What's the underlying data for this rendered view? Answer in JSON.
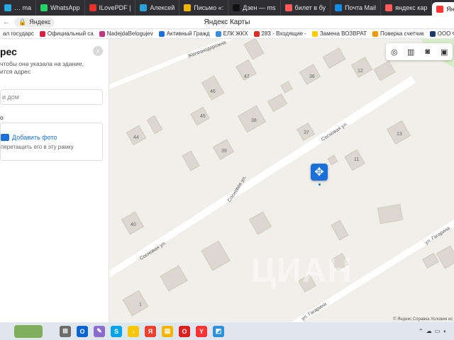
{
  "browser": {
    "tabs": [
      {
        "label": "… ma",
        "color": "#2aa8e0"
      },
      {
        "label": "WhatsApp",
        "color": "#25d366"
      },
      {
        "label": "ILovePDF |",
        "color": "#e5322d"
      },
      {
        "label": "Алексей",
        "color": "#2aa1da"
      },
      {
        "label": "Письмо «:",
        "color": "#f5b400"
      },
      {
        "label": "Дзен — ms",
        "color": "#111111"
      },
      {
        "label": "билет в бу",
        "color": "#ff5a5a"
      },
      {
        "label": "Почта Mail",
        "color": "#168de2"
      },
      {
        "label": "яндекс кар",
        "color": "#ff5a5a"
      },
      {
        "label": "Яндекс К",
        "color": "#ff3333",
        "active": true
      }
    ],
    "new_tab_label": "+",
    "site_chip": "Яндекс",
    "page_title": "Яндекс Карты"
  },
  "bookmarks": [
    {
      "label": "ал государс",
      "color": "#888888"
    },
    {
      "label": "Официальный са",
      "color": "#d4213d"
    },
    {
      "label": "NadejdaBelogujev",
      "color": "#c13584"
    },
    {
      "label": "Активный Гражд",
      "color": "#1e6fd9"
    },
    {
      "label": "ЕЛК ЖКХ",
      "color": "#3b8dd8"
    },
    {
      "label": "283 - Входящие -",
      "color": "#d93025"
    },
    {
      "label": "Замена ВОЗВРАТ",
      "color": "#ffcc00"
    },
    {
      "label": "Поверка счетчик",
      "color": "#f29900"
    },
    {
      "label": "ООО ФГИС",
      "color": "#1a3a6b"
    }
  ],
  "sidebar": {
    "title": "рес",
    "hint_line1": "чтобы она указала на здание,",
    "hint_line2": "ится адрес",
    "address_placeholder": "и дом",
    "section_label": "о",
    "add_photo_label": "Добавить фото",
    "add_photo_hint": "перетащить его в эту рамку",
    "close_label": "×"
  },
  "map": {
    "streets": {
      "zheleznodorozhnaya": "Железнодорожна",
      "sosnovaya_upper": "Сосновая ул.",
      "sosnovaya_mid": "Сосновая ул.",
      "sosnovaya_lower": "Сосновая ул.",
      "gagarina_upper": "ул. Гагарина",
      "gagarina_lower": "ул. Гагарина"
    },
    "house_numbers": [
      "47",
      "46",
      "36",
      "12",
      "45",
      "38",
      "44",
      "37",
      "13",
      "39",
      "11",
      "40",
      "1"
    ],
    "watermark": "ЦИАН",
    "copyright": "© Яндекс  Справка  Условия ис"
  },
  "taskbar": {
    "apps": [
      {
        "name": "file-explorer",
        "color": "#6b6b6b",
        "glyph": "⊞"
      },
      {
        "name": "outlook",
        "color": "#0a64d0",
        "glyph": "O"
      },
      {
        "name": "paint",
        "color": "#8a6cc9",
        "glyph": "✎"
      },
      {
        "name": "skype",
        "color": "#00a3e6",
        "glyph": "S"
      },
      {
        "name": "yandex-music",
        "color": "#f8c600",
        "glyph": "♪"
      },
      {
        "name": "yandex",
        "color": "#ef3f2f",
        "glyph": "Я"
      },
      {
        "name": "folder",
        "color": "#f5b400",
        "glyph": "▤"
      },
      {
        "name": "opera",
        "color": "#e0201f",
        "glyph": "O"
      },
      {
        "name": "yandex-browser",
        "color": "#ff3333",
        "glyph": "Y"
      },
      {
        "name": "photos",
        "color": "#2d8fd5",
        "glyph": "◩"
      }
    ]
  },
  "colors": {
    "accent": "#1a6fd8",
    "map_background": "#f1efe9",
    "building": "#dcd8d0",
    "road": "#ffffff"
  }
}
